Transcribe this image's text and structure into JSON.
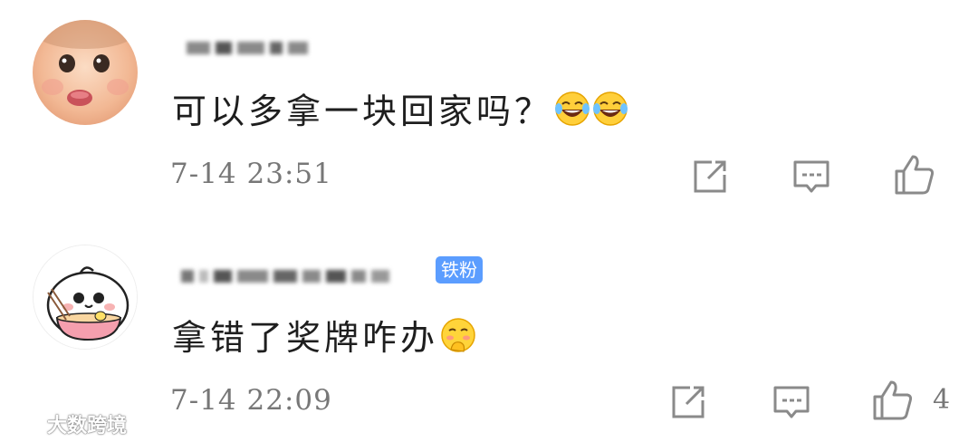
{
  "comments": [
    {
      "content": "可以多拿一块回家吗？",
      "emojis": [
        "laugh-cry-emoji",
        "laugh-cry-emoji"
      ],
      "timestamp": "7-14 23:51"
    },
    {
      "content": "拿错了奖牌咋办",
      "badge": "铁粉",
      "emojis": [
        "shy-emoji"
      ],
      "timestamp": "7-14 22:09",
      "like_count": "4"
    }
  ],
  "watermark": "大数跨境",
  "colors": {
    "text": "#1e1e1e",
    "meta": "#777777",
    "icon": "#8a8a8a",
    "badge": "#5b9dff"
  }
}
